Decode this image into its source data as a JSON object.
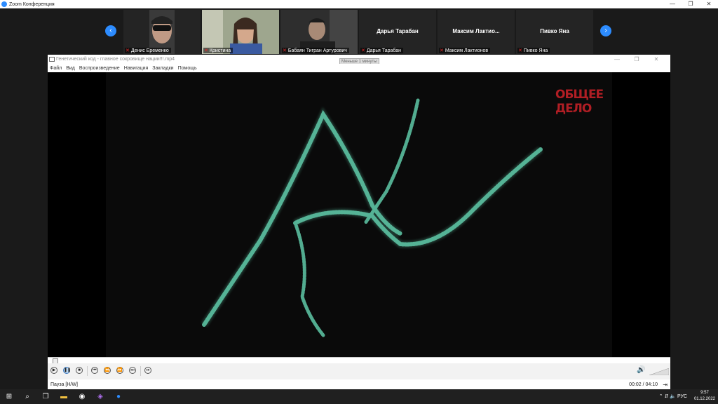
{
  "zoom": {
    "title": "Zoom Конференция",
    "window_controls": [
      "—",
      "❐",
      "✕"
    ]
  },
  "gallery": {
    "prev_icon": "‹",
    "next_icon": "›",
    "participants": [
      {
        "name": "Денис Еременко",
        "muted": true
      },
      {
        "name": "Кристина",
        "muted": true
      },
      {
        "name": "Бабаян Тигран Артурович",
        "muted": true
      },
      {
        "name": "Дарья Тарабан",
        "display": "Дарья Тарабан",
        "muted": true
      },
      {
        "name": "Максим Лактионов",
        "display": "Максим  Лактио...",
        "muted": true
      },
      {
        "name": "Пивко Яна",
        "display": "Пивко Яна",
        "muted": true
      }
    ]
  },
  "player": {
    "file_title": "Генетический код - главное сокровище нации!!!.mp4",
    "tooltip": "Меньше 1 минуты",
    "controls": [
      "—",
      "❐",
      "✕"
    ],
    "menu": [
      "Файл",
      "Вид",
      "Воспроизведение",
      "Навигация",
      "Закладки",
      "Помощь"
    ],
    "logo": [
      "ОБЩЕЕ",
      "ДЕЛО"
    ],
    "status": "Пауза [H/W]",
    "time": "00:02 / 04:10",
    "progress": 0.008,
    "volume": 0.9,
    "colors": {
      "dna": "#5fc9a8",
      "logo": "#b01e24",
      "accent": "#2d8cff"
    }
  },
  "taskbar": {
    "time": "9:57",
    "date": "01.12.2022",
    "lang": "РУС"
  }
}
